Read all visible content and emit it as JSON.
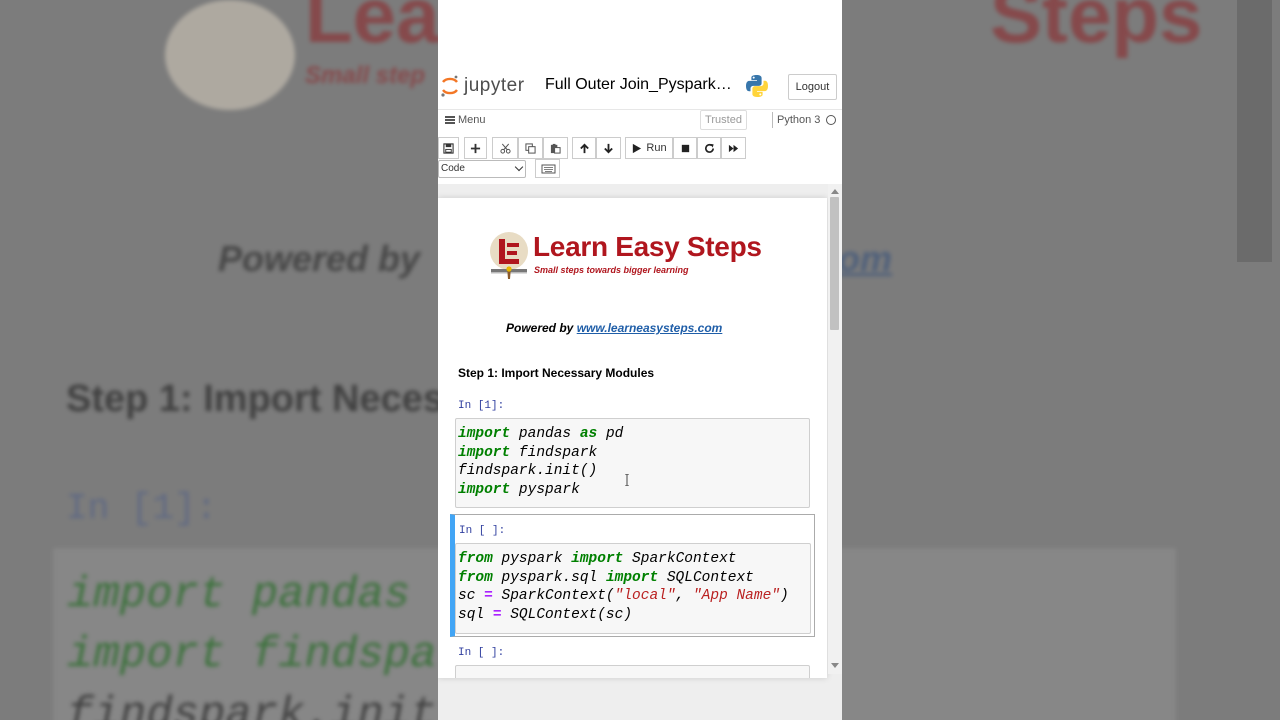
{
  "background": {
    "logo_word_left": "Lea",
    "logo_word_right": "Steps",
    "tagline": "Small step",
    "powered_by": "Powered by",
    "site_fragment": "om",
    "step_heading": "Step 1: Import Necess",
    "prompt": "In [1]:",
    "lines": [
      "import pandas",
      "import findspa",
      "findspark.init"
    ]
  },
  "header": {
    "app_name": "jupyter",
    "notebook_title": "Full Outer Join_Pyspark…",
    "logout_label": "Logout"
  },
  "menubar": {
    "menu_label": "Menu",
    "trusted_label": "Trusted",
    "kernel_name": "Python 3"
  },
  "toolbar": {
    "run_label": "Run",
    "cell_type": "Code"
  },
  "notebook": {
    "brand_name": "Learn Easy Steps",
    "brand_tagline": "Small steps towards bigger learning",
    "powered_prefix": "Powered by",
    "powered_link": "www.learneasysteps.com",
    "step_heading": "Step 1: Import Necessary Modules",
    "cells": [
      {
        "prompt": "In [1]:",
        "lines": [
          "import pandas as pd",
          "import findspark",
          "findspark.init()",
          "import pyspark"
        ]
      },
      {
        "prompt": "In [ ]:",
        "lines": [
          "from pyspark import SparkContext",
          "from pyspark.sql import SQLContext",
          "sc = SparkContext(\"local\", \"App Name\")",
          "sql = SQLContext(sc)"
        ]
      },
      {
        "prompt": "In [ ]:"
      }
    ]
  },
  "colors": {
    "brand_red": "#b0161e",
    "keyword_green": "#008000",
    "string_red": "#ba2121",
    "prompt_blue": "#303f9f",
    "selection_blue": "#42a5f5",
    "link_blue": "#1f5ea8"
  }
}
